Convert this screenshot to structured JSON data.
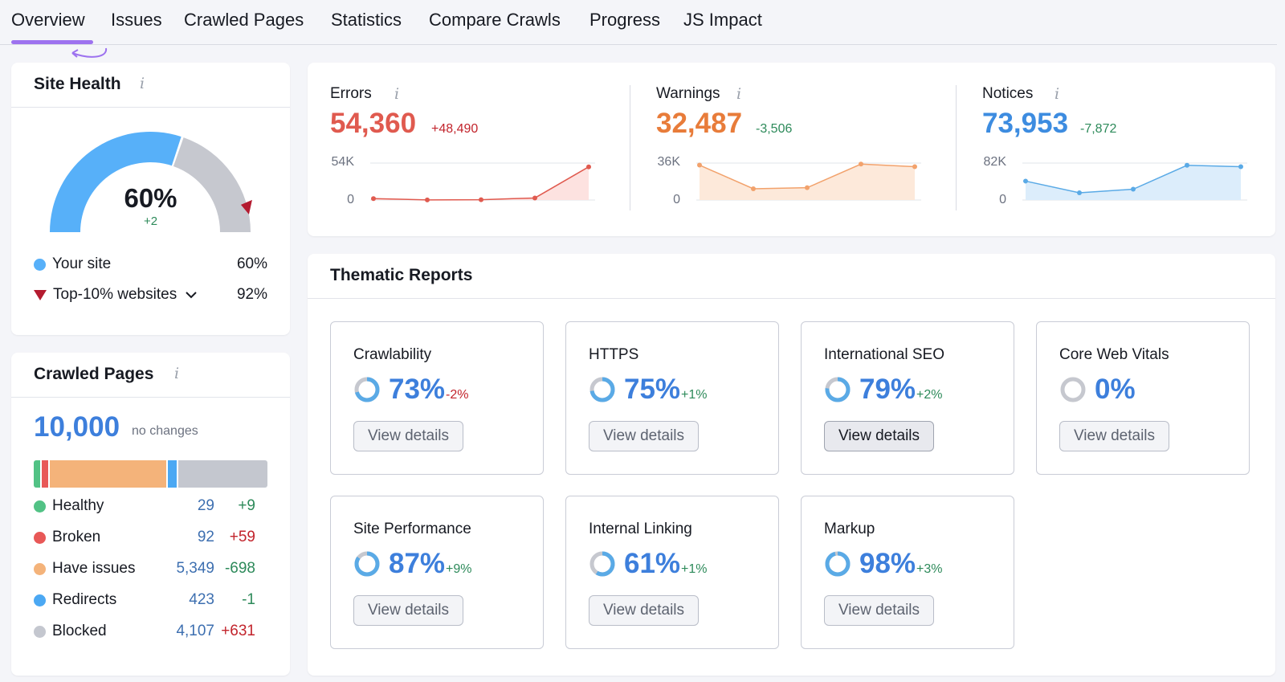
{
  "tabs": [
    "Overview",
    "Issues",
    "Crawled Pages",
    "Statistics",
    "Compare Crawls",
    "Progress",
    "JS Impact"
  ],
  "site_health": {
    "title": "Site Health",
    "percent": "60%",
    "change": "+2",
    "gauge_fill": 0.6,
    "top10_marker": 0.92,
    "legend": [
      {
        "label": "Your site",
        "value": "60%",
        "color": "#57b0f9"
      },
      {
        "label": "Top-10% websites",
        "value": "92%",
        "color": "#b41b30"
      }
    ]
  },
  "crawled_pages": {
    "title": "Crawled Pages",
    "total": "10,000",
    "total_note": "no changes",
    "rows": [
      {
        "label": "Healthy",
        "count": "29",
        "change": "+9",
        "color": "#52c285",
        "change_color": "#2d8a5a"
      },
      {
        "label": "Broken",
        "count": "92",
        "change": "+59",
        "color": "#e85857",
        "change_color": "#c2242c"
      },
      {
        "label": "Have issues",
        "count": "5,349",
        "change": "-698",
        "color": "#f4b37a",
        "change_color": "#2d8a5a"
      },
      {
        "label": "Redirects",
        "count": "423",
        "change": "-1",
        "color": "#4ba8f3",
        "change_color": "#2d8a5a"
      },
      {
        "label": "Blocked",
        "count": "4,107",
        "change": "+631",
        "color": "#c4c7cf",
        "change_color": "#c2242c"
      }
    ]
  },
  "metrics": [
    {
      "label": "Errors",
      "value": "54,360",
      "delta": "+48,490",
      "color": "#e05a4f",
      "delta_color": "#c2242c",
      "ymax_label": "54K",
      "ymin_label": "0",
      "fill": "#fde2e0",
      "line": "#e05a4f"
    },
    {
      "label": "Warnings",
      "value": "32,487",
      "delta": "-3,506",
      "color": "#e87c3a",
      "delta_color": "#2d8a5a",
      "ymax_label": "36K",
      "ymin_label": "0",
      "fill": "#fde9da",
      "line": "#f2a26c"
    },
    {
      "label": "Notices",
      "value": "73,953",
      "delta": "-7,872",
      "color": "#3d8ce0",
      "delta_color": "#2d8a5a",
      "ymax_label": "82K",
      "ymin_label": "0",
      "fill": "#dcedfb",
      "line": "#5aaae6"
    }
  ],
  "chart_data": [
    {
      "type": "area",
      "title": "",
      "ylim": [
        0,
        54000
      ],
      "values": [
        2000,
        200,
        500,
        3000,
        48490
      ]
    },
    {
      "type": "area",
      "title": "",
      "ylim": [
        0,
        36000
      ],
      "values": [
        34000,
        11000,
        12000,
        35000,
        32487
      ]
    },
    {
      "type": "area",
      "title": "",
      "ylim": [
        0,
        82000
      ],
      "values": [
        42000,
        16000,
        24000,
        77000,
        73953
      ]
    }
  ],
  "thematic": {
    "title": "Thematic Reports",
    "button_label": "View details",
    "reports": [
      {
        "name": "Crawlability",
        "percent": "73%",
        "delta": "-2%",
        "delta_color": "#c2242c",
        "fraction": 0.73
      },
      {
        "name": "HTTPS",
        "percent": "75%",
        "delta": "+1%",
        "delta_color": "#2d8a5a",
        "fraction": 0.75
      },
      {
        "name": "International SEO",
        "percent": "79%",
        "delta": "+2%",
        "delta_color": "#2d8a5a",
        "fraction": 0.79
      },
      {
        "name": "Core Web Vitals",
        "percent": "0%",
        "delta": "",
        "delta_color": "#2d8a5a",
        "fraction": 0
      },
      {
        "name": "Site Performance",
        "percent": "87%",
        "delta": "+9%",
        "delta_color": "#2d8a5a",
        "fraction": 0.87
      },
      {
        "name": "Internal Linking",
        "percent": "61%",
        "delta": "+1%",
        "delta_color": "#2d8a5a",
        "fraction": 0.61
      },
      {
        "name": "Markup",
        "percent": "98%",
        "delta": "+3%",
        "delta_color": "#2d8a5a",
        "fraction": 0.98
      }
    ]
  }
}
